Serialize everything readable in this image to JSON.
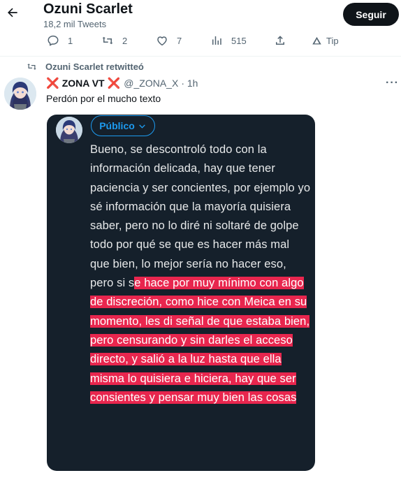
{
  "header": {
    "profile_name": "Ozuni Scarlet",
    "tweet_count": "18,2 mil Tweets",
    "follow_label": "Seguir"
  },
  "actions": {
    "replies": "1",
    "retweets": "2",
    "likes": "7",
    "views": "515",
    "tip": "Tip"
  },
  "retweet_banner": "Ozuni Scarlet retwitteó",
  "tweet": {
    "x_mark": "❌",
    "author": "ZONA VT",
    "handle": "@_ZONA_X",
    "time": "· 1h",
    "more": "···",
    "text": "Perdón por el mucho texto"
  },
  "media": {
    "audience_label": "Público",
    "text_plain": "Bueno, se descontroló todo con la información delicada, hay que tener paciencia y ser concientes, por ejemplo yo sé información que la mayoría quisiera saber, pero no lo diré ni soltaré de golpe todo por qué se que es hacer más mal que bien, lo mejor sería no hacer eso, pero si s",
    "text_highlight": "e hace por muy mínimo con algo de discreción, como hice con Meica en su momento, les di señal de que estaba bien, pero censurando y sin darles el acceso directo, y salió a la luz hasta que ella misma lo quisiera e hiciera, hay que ser consientes y pensar muy bien las cosas"
  },
  "colors": {
    "accent": "#1d9bf0",
    "highlight": "#e8264e",
    "media_bg": "#15202b",
    "x_mark": "#e2272f"
  }
}
